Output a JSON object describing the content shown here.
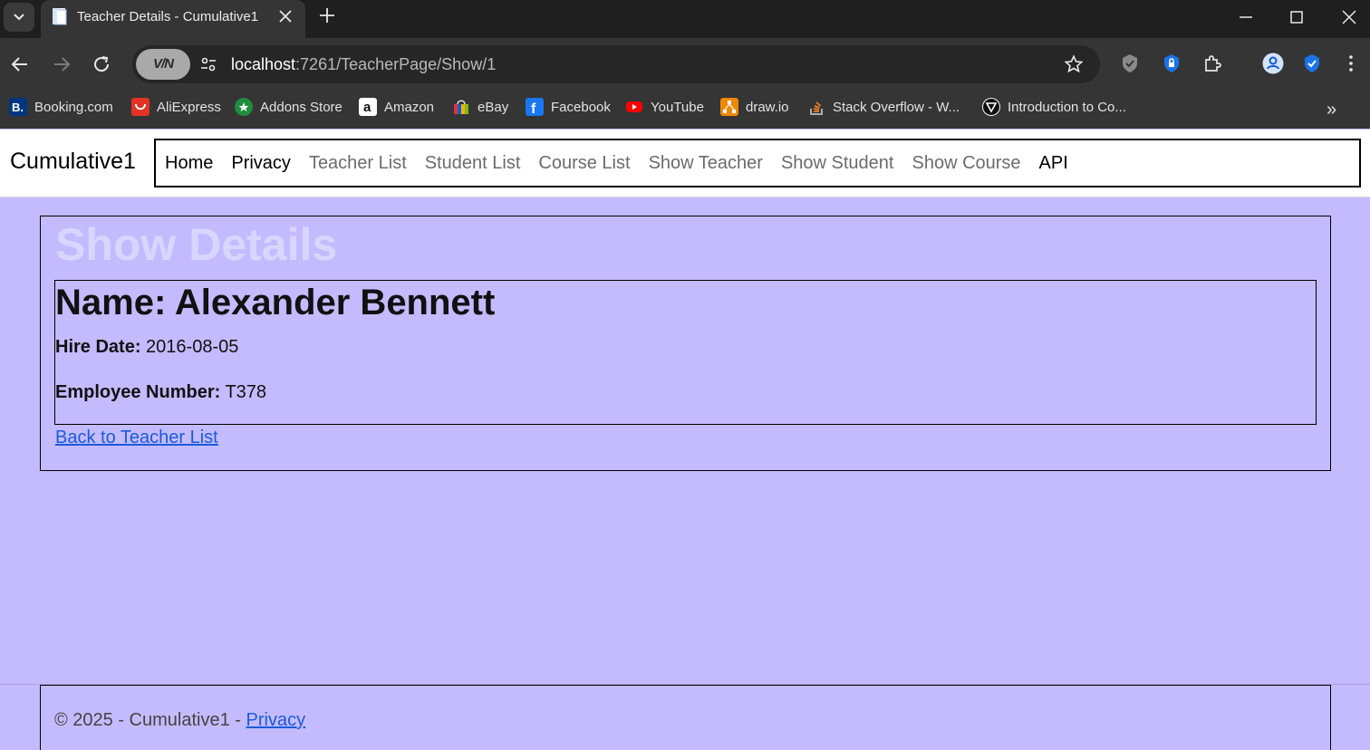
{
  "browser": {
    "tab_title": "Teacher Details - Cumulative1",
    "url_host": "localhost",
    "url_rest": ":7261/TeacherPage/Show/1",
    "vpn_label": "V/N",
    "bookmarks": [
      {
        "label": "Booking.com",
        "icon": "booking-icon",
        "color": "#003580"
      },
      {
        "label": "AliExpress",
        "icon": "aliexpress-icon",
        "color": "#e43225"
      },
      {
        "label": "Addons Store",
        "icon": "addons-store-icon",
        "color": "#1e8e3e"
      },
      {
        "label": "Amazon",
        "icon": "amazon-icon",
        "color": "#ffffff"
      },
      {
        "label": "eBay",
        "icon": "ebay-icon",
        "color": "#e53238"
      },
      {
        "label": "Facebook",
        "icon": "facebook-icon",
        "color": "#1877f2"
      },
      {
        "label": "YouTube",
        "icon": "youtube-icon",
        "color": "#ff0000"
      },
      {
        "label": "draw.io",
        "icon": "drawio-icon",
        "color": "#f08705"
      },
      {
        "label": "Stack Overflow - W...",
        "icon": "stackoverflow-icon",
        "color": "#f48024"
      },
      {
        "label": "Introduction to Co...",
        "icon": "introduction-icon",
        "color": "#ffffff"
      }
    ],
    "more_label": "»"
  },
  "site": {
    "brand": "Cumulative1",
    "nav": [
      "Home",
      "Privacy",
      "Teacher List",
      "Student List",
      "Course List",
      "Show Teacher",
      "Show Student",
      "Show Course",
      "API"
    ]
  },
  "main": {
    "heading": "Show Details",
    "name_line": "Name: Alexander Bennett",
    "hire_label": "Hire Date:",
    "hire_value": "2016-08-05",
    "employee_label": "Employee Number:",
    "employee_value": "T378",
    "back_link": "Back to Teacher List"
  },
  "footer": {
    "text": "© 2025 - Cumulative1 - ",
    "privacy": "Privacy"
  },
  "colors": {
    "page_bg": "#c4bbff",
    "heading": "#d8d6ff",
    "link": "#1a5bd8"
  }
}
